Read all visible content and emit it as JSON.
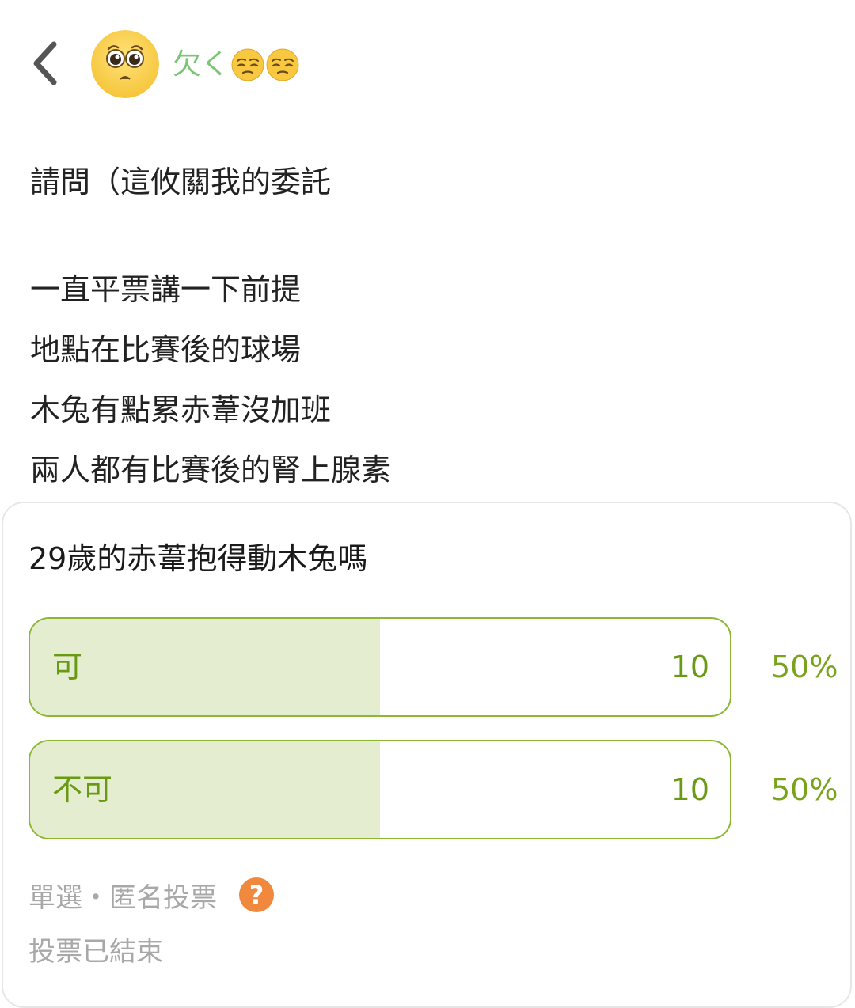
{
  "header": {
    "back_icon": "chevron-left-icon",
    "avatar_icon": "pleading-face-emoji",
    "author_name": "欠く",
    "author_emojis": [
      "relieved-face-emoji",
      "relieved-face-emoji"
    ]
  },
  "post": {
    "lines": [
      "請問（這攸關我的委託",
      "一直平票講一下前提",
      "地點在比賽後的球場",
      "木兔有點累赤葦沒加班",
      "兩人都有比賽後的腎上腺素"
    ]
  },
  "poll": {
    "question": "29歲的赤葦抱得動木兔嗎",
    "options": [
      {
        "label": "可",
        "count": "10",
        "percent": "50%",
        "fraction": 0.5
      },
      {
        "label": "不可",
        "count": "10",
        "percent": "50%",
        "fraction": 0.5
      }
    ],
    "meta": "單選・匿名投票",
    "help_icon": "question-mark-icon",
    "help_glyph": "?",
    "status": "投票已結束"
  },
  "colors": {
    "author": "#7cc576",
    "option_border": "#8bb733",
    "option_fill": "#e4edd0",
    "option_text": "#6a9a14",
    "help_icon_bg": "#f0883e",
    "meta_text": "#a8a8a8"
  }
}
